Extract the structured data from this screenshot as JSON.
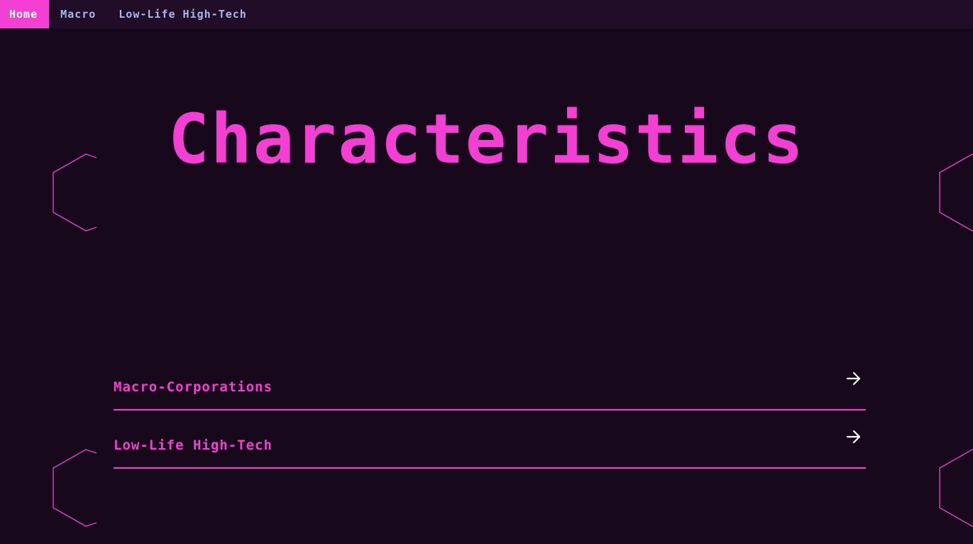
{
  "nav": {
    "items": [
      {
        "label": "Home",
        "active": true
      },
      {
        "label": "Macro",
        "active": false
      },
      {
        "label": "Low-Life High-Tech",
        "active": false
      }
    ]
  },
  "hero": {
    "title": "Characteristics"
  },
  "characteristics": [
    {
      "label": "Macro-Corporations",
      "icon": "arrow-right-icon"
    },
    {
      "label": "Low-Life High-Tech",
      "icon": "arrow-right-icon"
    }
  ],
  "colors": {
    "background": "#18081b",
    "nav_background": "#220d28",
    "accent": "#f33fd3",
    "nav_text": "#a9b7f0",
    "icon": "#ffffff"
  }
}
